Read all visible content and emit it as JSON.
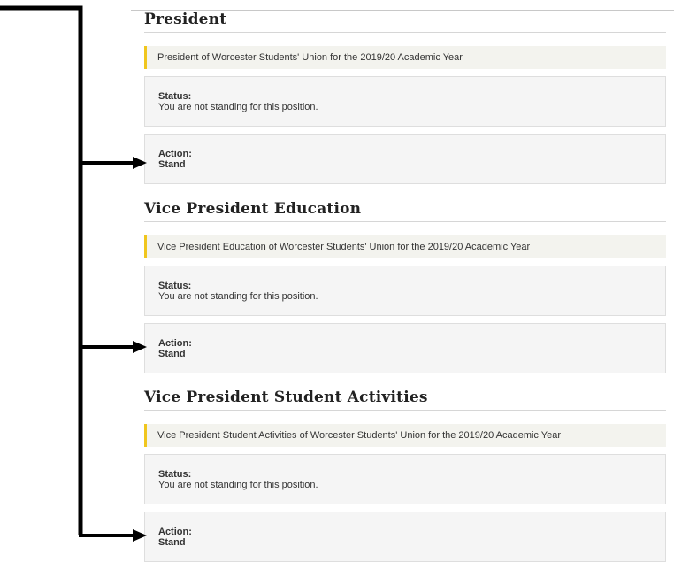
{
  "positions": [
    {
      "title": "President",
      "description": "President of Worcester Students' Union for the 2019/20 Academic Year",
      "status_label": "Status:",
      "status_text": "You are not standing for this position.",
      "action_label": "Action:",
      "action_text": "Stand"
    },
    {
      "title": "Vice President Education",
      "description": "Vice President Education of Worcester Students' Union for the 2019/20 Academic Year",
      "status_label": "Status:",
      "status_text": "You are not standing for this position.",
      "action_label": "Action:",
      "action_text": "Stand"
    },
    {
      "title": "Vice President Student Activities",
      "description": "Vice President Student Activities of Worcester Students' Union for the 2019/20 Academic Year",
      "status_label": "Status:",
      "status_text": "You are not standing for this position.",
      "action_label": "Action:",
      "action_text": "Stand"
    }
  ],
  "colors": {
    "accent": "#f0c61e",
    "panel": "#f5f5f5",
    "callout": "#000000"
  }
}
